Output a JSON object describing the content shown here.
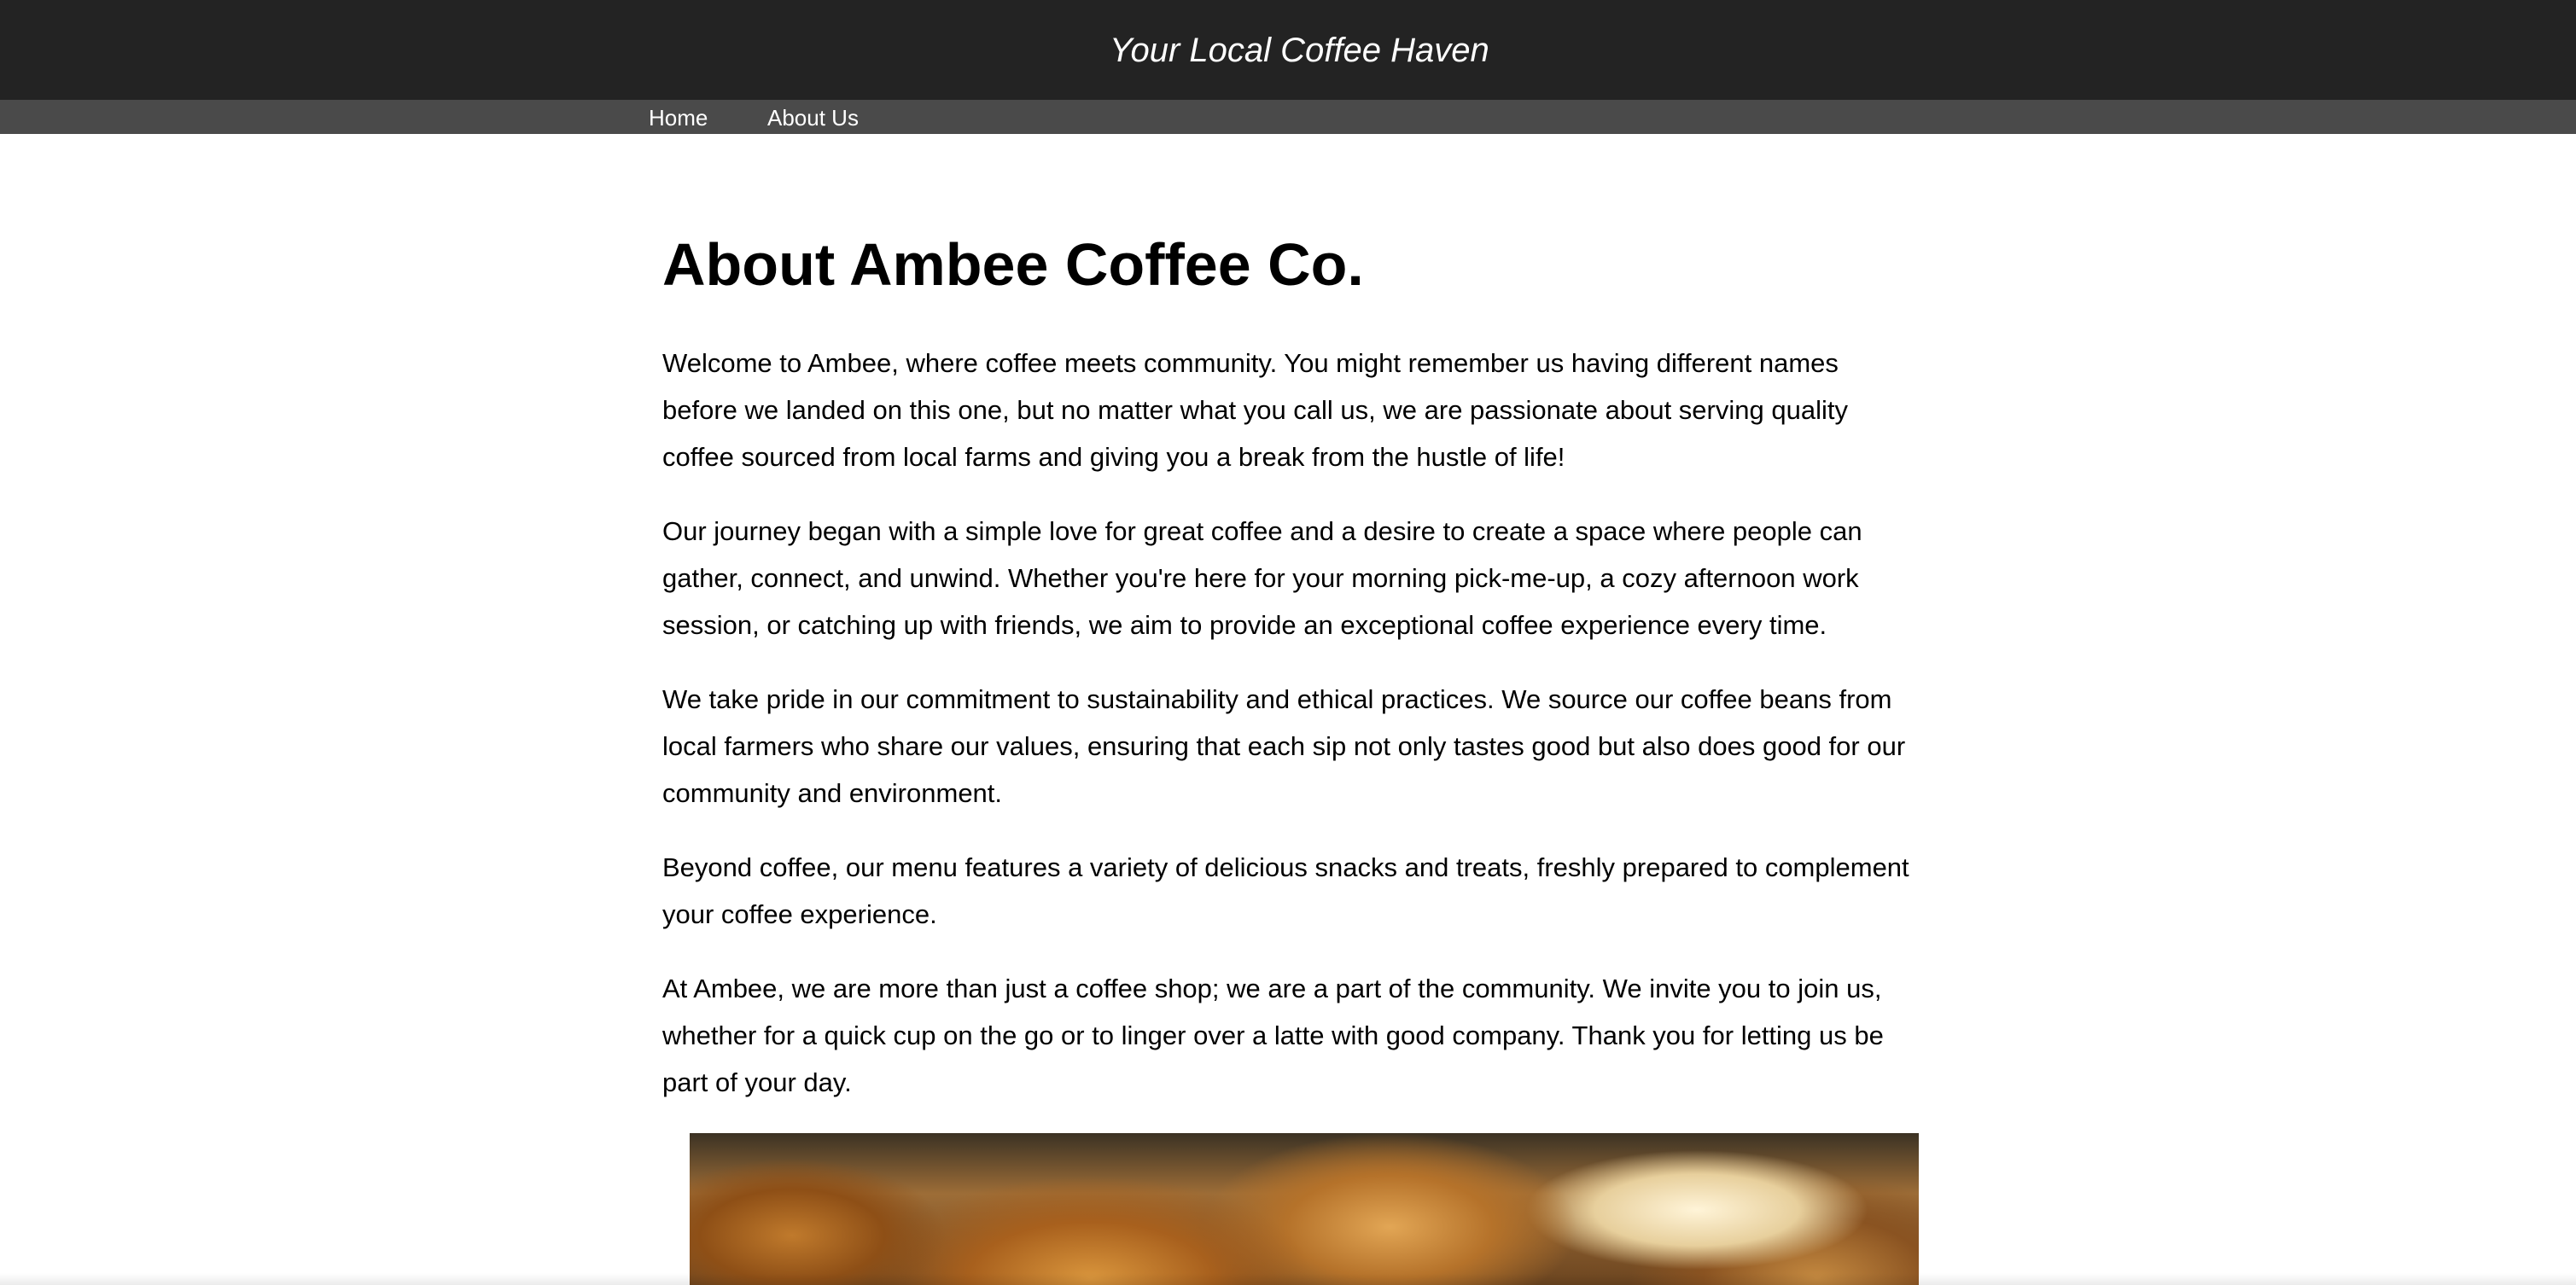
{
  "header": {
    "tagline": "Your Local Coffee Haven"
  },
  "nav": {
    "items": [
      {
        "label": "Home"
      },
      {
        "label": "About Us"
      }
    ]
  },
  "main": {
    "title": "About Ambee Coffee Co.",
    "paragraphs": [
      "Welcome to Ambee, where coffee meets community. You might remember us having different names before we landed on this one, but no matter what you call us, we are passionate about serving quality coffee sourced from local farms and giving you a break from the hustle of life!",
      "Our journey began with a simple love for great coffee and a desire to create a space where people can gather, connect, and unwind. Whether you're here for your morning pick-me-up, a cozy afternoon work session, or catching up with friends, we aim to provide an exceptional coffee experience every time.",
      "We take pride in our commitment to sustainability and ethical practices. We source our coffee beans from local farmers who share our values, ensuring that each sip not only tastes good but also does good for our community and environment.",
      "Beyond coffee, our menu features a variety of delicious snacks and treats, freshly prepared to complement your coffee experience.",
      "At Ambee, we are more than just a coffee shop; we are a part of the community. We invite you to join us, whether for a quick cup on the go or to linger over a latte with good company. Thank you for letting us be part of your day."
    ]
  },
  "colors": {
    "header_bg": "#232323",
    "nav_bg": "#4a4a4a",
    "text": "#000000",
    "nav_text": "#ffffff"
  }
}
